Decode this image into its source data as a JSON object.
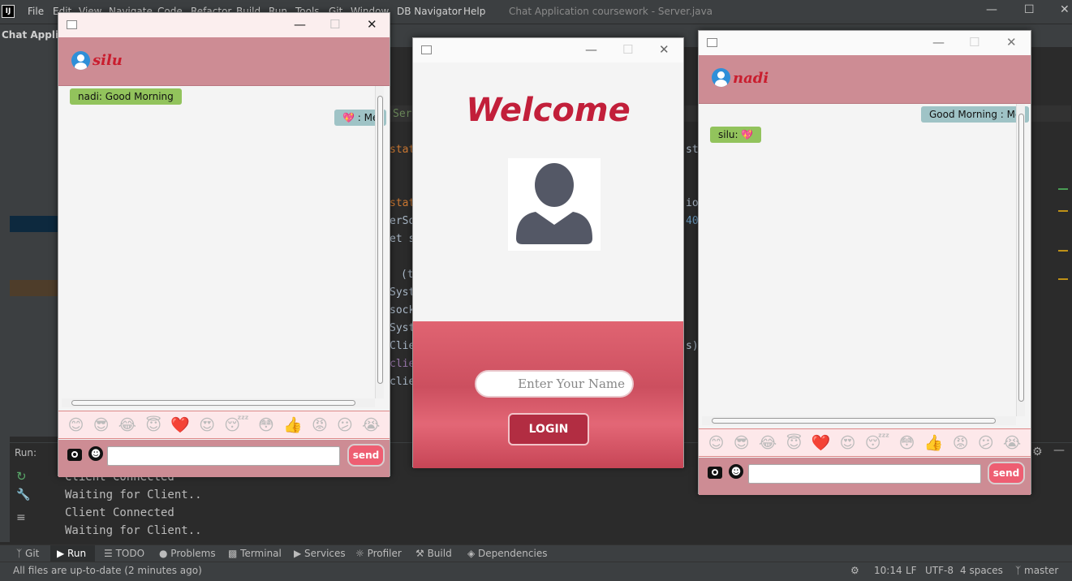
{
  "ide": {
    "title": "Chat Application coursework - Server.java",
    "logo": "IJ",
    "menu": [
      "File",
      "Edit",
      "View",
      "Navigate",
      "Code",
      "Refactor",
      "Build",
      "Run",
      "Tools",
      "Git",
      "Window",
      "DB Navigator",
      "Help"
    ],
    "project_name": "Chat Applicat",
    "run_label": "Run:",
    "run_output": [
      "Client Connected",
      "Waiting for Client..",
      "Client Connected",
      "Waiting for Client.."
    ],
    "bottom_tabs": [
      "Git",
      "Run",
      "TODO",
      "Problems",
      "Terminal",
      "Services",
      "Profiler",
      "Build",
      "Dependencies"
    ],
    "status": {
      "message": "All files are up-to-date (2 minutes ago)",
      "time": "10:14",
      "line_sep": "LF",
      "encoding": "UTF-8",
      "indent": "4 spaces",
      "branch": "master"
    },
    "code_fragments": [
      "Serv",
      "stati",
      "stati",
      "erSo",
      "et s",
      "(t",
      "Syst",
      "sock",
      "Syst",
      "Clie",
      "clie",
      "clie",
      "st",
      "io",
      "40",
      "s)"
    ]
  },
  "chat_silu": {
    "username": "silu",
    "messages": [
      {
        "text": "nadi: Good Morning",
        "side": "left"
      },
      {
        "text": "💖 : Me",
        "side": "right"
      }
    ],
    "send_label": "send",
    "message_value": ""
  },
  "chat_nadi": {
    "username": "nadi",
    "messages": [
      {
        "text": "Good Morning : Me",
        "side": "right"
      },
      {
        "text": "silu: 💖",
        "side": "left"
      }
    ],
    "send_label": "send",
    "message_value": ""
  },
  "emojis": [
    "😊",
    "😎",
    "😂",
    "😇",
    "❤️",
    "😍",
    "😴",
    "😳",
    "👍",
    "😡",
    "😕",
    "😭"
  ],
  "login": {
    "welcome": "Welcome",
    "name_placeholder": "Enter Your Name",
    "login_label": "LOGIN"
  },
  "colors": {
    "header_pink": "#cd8c94",
    "username_red": "#c91d2e",
    "send_button": "#ee5e72",
    "bubble_green": "#92c35c",
    "bubble_blue": "#9fc3c6",
    "login_button": "#b22d42"
  }
}
